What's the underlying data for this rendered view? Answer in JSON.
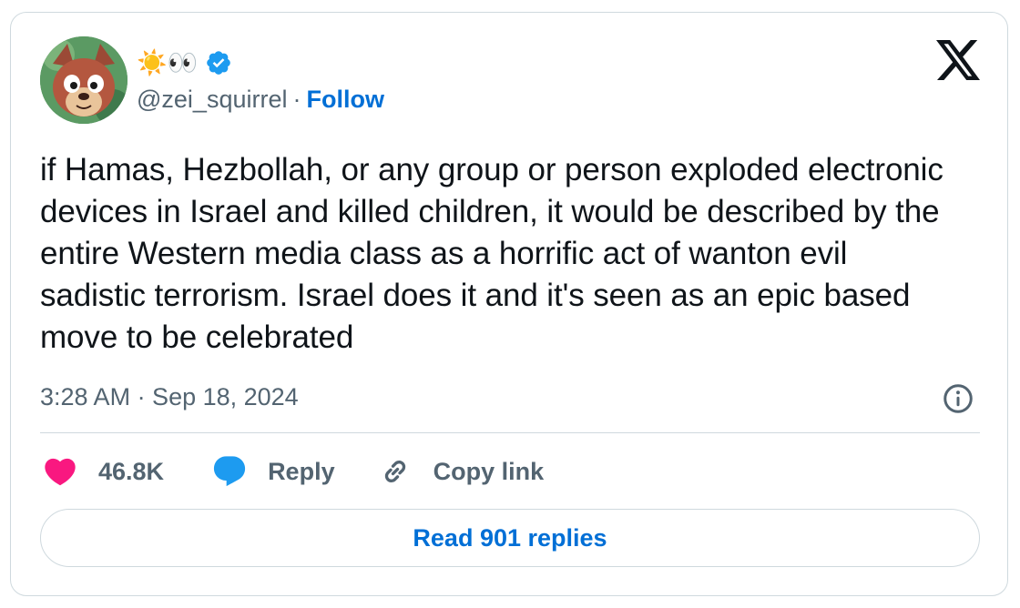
{
  "author": {
    "display_name_emojis": "☀️👀",
    "handle": "@zei_squirrel",
    "separator": "·",
    "follow_label": "Follow",
    "verified": true
  },
  "tweet": {
    "text": "if Hamas, Hezbollah, or any group or person exploded electronic devices in Israel and killed children, it would be described by the entire Western media class as a horrific act of wanton evil sadistic terrorism. Israel does it and it's seen as an epic based move to be celebrated",
    "timestamp": "3:28 AM · Sep 18, 2024"
  },
  "actions": {
    "likes": "46.8K",
    "reply_label": "Reply",
    "copy_link_label": "Copy link"
  },
  "read_replies_label": "Read 901 replies",
  "colors": {
    "accent": "#006fd6",
    "like": "#f91880",
    "reply": "#1d9bf0",
    "muted": "#536471",
    "border": "#cfd9de"
  },
  "icons": [
    "avatar-squirrel",
    "verified-badge-icon",
    "x-logo-icon",
    "info-icon",
    "heart-icon",
    "reply-bubble-icon",
    "link-icon"
  ]
}
